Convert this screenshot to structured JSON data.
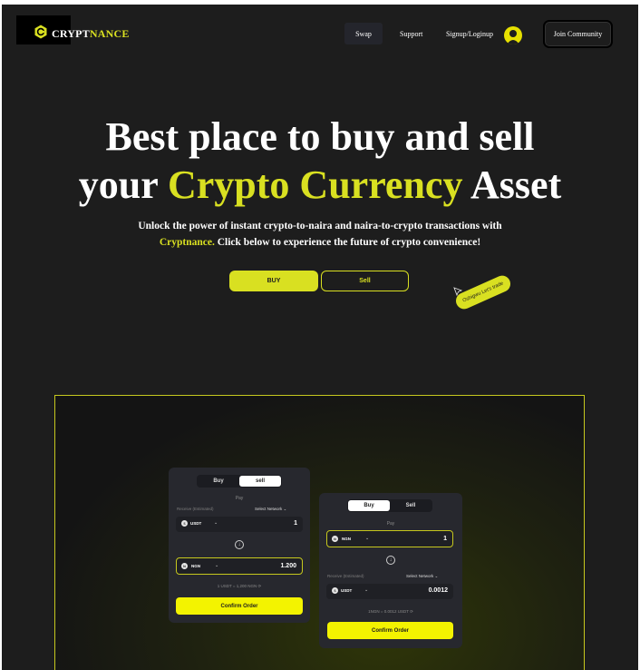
{
  "brand": {
    "logo_main": "CRYPT",
    "logo_accent": "NANCE"
  },
  "nav": {
    "swap": "Swap",
    "support": "Support",
    "signup": "Signup/Loginup",
    "join": "Join Community"
  },
  "hero": {
    "title_line1": "Best place to buy and sell",
    "title_line2_pre": "your ",
    "title_line2_accent": "Crypto Currency",
    "title_line2_post": " Asset",
    "subtitle_line1": "Unlock the power of instant crypto-to-naira and naira-to-crypto transactions with",
    "subtitle_brand": "Cryptnance.",
    "subtitle_line2": " Click below to experience the future of crypto convenience!",
    "buy_label": "BUY",
    "sell_label": "Sell",
    "trade_tag": "Oshigwu Let's trade"
  },
  "card_sell": {
    "tab_buy": "Buy",
    "tab_sell": "sell",
    "active_tab": "sell",
    "pay_label": "Pay",
    "receive_label": "Receive (Estimated)",
    "network_label": "Select Network",
    "from_coin": "USDT",
    "from_amount": "1",
    "to_coin": "NGN",
    "to_amount": "1.200",
    "rate": "1 USDT = 1,200 NGN",
    "confirm": "Confirm Order"
  },
  "card_buy": {
    "tab_buy": "Buy",
    "tab_sell": "Sell",
    "active_tab": "Buy",
    "pay_label": "Pay",
    "receive_label": "Receive (Estimated)",
    "network_label": "Select Network",
    "from_coin": "NGN",
    "from_amount": "1",
    "to_coin": "USDT",
    "to_amount": "0.0012",
    "rate": "1NGN = 0.0012 USDT",
    "confirm": "Confirm Order"
  },
  "colors": {
    "accent": "#d9e021",
    "background": "#1d1d1d",
    "card": "#27282e",
    "confirm": "#f3f300"
  }
}
